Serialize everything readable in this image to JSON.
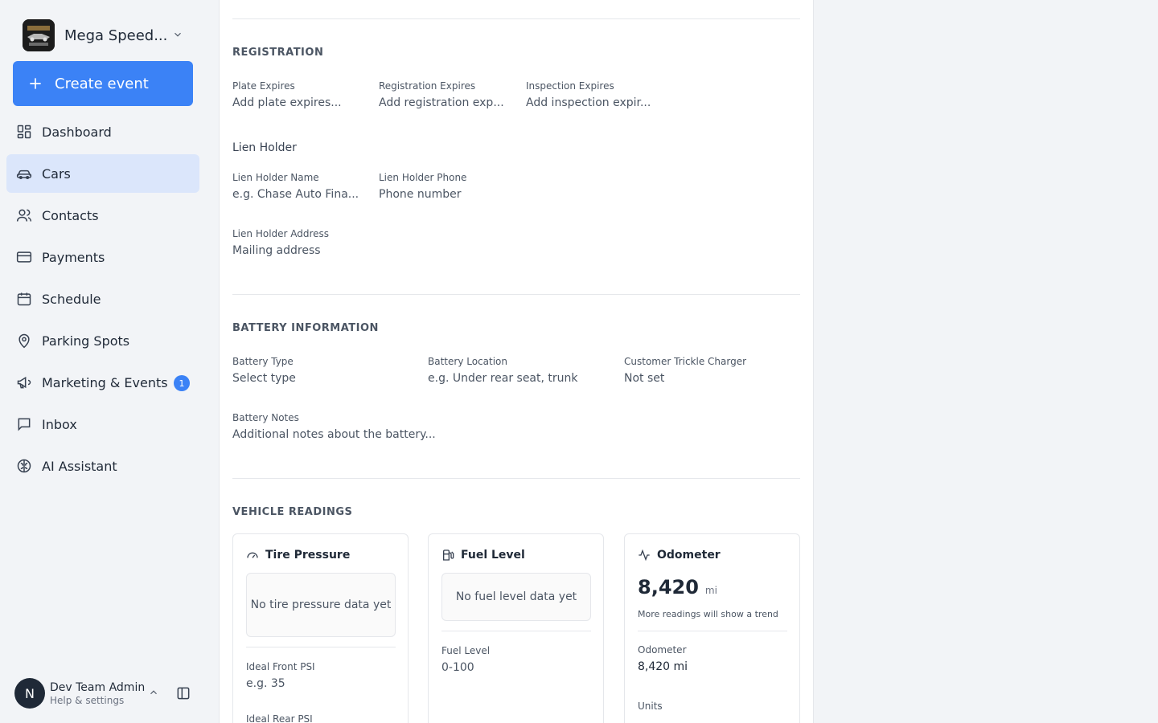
{
  "brand": {
    "name": "Mega Speed...",
    "logo_text": "MEGA SPEED STORAGE"
  },
  "create_button": {
    "label": "Create event"
  },
  "nav": [
    {
      "label": "Dashboard",
      "icon": "dashboard-icon"
    },
    {
      "label": "Cars",
      "icon": "car-icon",
      "active": true
    },
    {
      "label": "Contacts",
      "icon": "contacts-icon"
    },
    {
      "label": "Payments",
      "icon": "credit-card-icon"
    },
    {
      "label": "Schedule",
      "icon": "calendar-icon"
    },
    {
      "label": "Parking Spots",
      "icon": "map-pin-icon"
    },
    {
      "label": "Marketing & Events",
      "icon": "megaphone-icon",
      "badge": "1"
    },
    {
      "label": "Inbox",
      "icon": "message-square-icon"
    },
    {
      "label": "AI Assistant",
      "icon": "brain-icon"
    }
  ],
  "user": {
    "initial": "N",
    "name": "Dev Team Admin",
    "subtitle": "Help & settings"
  },
  "registration": {
    "title": "REGISTRATION",
    "plate_expires": {
      "label": "Plate Expires",
      "placeholder": "Add plate expires..."
    },
    "registration_expires": {
      "label": "Registration Expires",
      "placeholder": "Add registration exp..."
    },
    "inspection_expires": {
      "label": "Inspection Expires",
      "placeholder": "Add inspection expir..."
    },
    "lien_holder_heading": "Lien Holder",
    "lien_holder_name": {
      "label": "Lien Holder Name",
      "placeholder": "e.g. Chase Auto Fina..."
    },
    "lien_holder_phone": {
      "label": "Lien Holder Phone",
      "placeholder": "Phone number"
    },
    "lien_holder_address": {
      "label": "Lien Holder Address",
      "placeholder": "Mailing address"
    }
  },
  "battery": {
    "title": "BATTERY INFORMATION",
    "type": {
      "label": "Battery Type",
      "value": "Select type"
    },
    "location": {
      "label": "Battery Location",
      "placeholder": "e.g. Under rear seat, trunk"
    },
    "trickle_charger": {
      "label": "Customer Trickle Charger",
      "value": "Not set"
    },
    "notes": {
      "label": "Battery Notes",
      "placeholder": "Additional notes about the battery..."
    }
  },
  "readings": {
    "title": "VEHICLE READINGS",
    "tire": {
      "title": "Tire Pressure",
      "empty": "No tire pressure data yet",
      "front": {
        "label": "Ideal Front PSI",
        "placeholder": "e.g. 35"
      },
      "rear": {
        "label": "Ideal Rear PSI"
      }
    },
    "fuel": {
      "title": "Fuel Level",
      "empty": "No fuel level data yet",
      "field": {
        "label": "Fuel Level",
        "placeholder": "0-100"
      }
    },
    "odometer": {
      "title": "Odometer",
      "value": "8,420",
      "unit": "mi",
      "note": "More readings will show a trend",
      "field": {
        "label": "Odometer",
        "value": "8,420 mi"
      },
      "units_label": "Units"
    }
  }
}
